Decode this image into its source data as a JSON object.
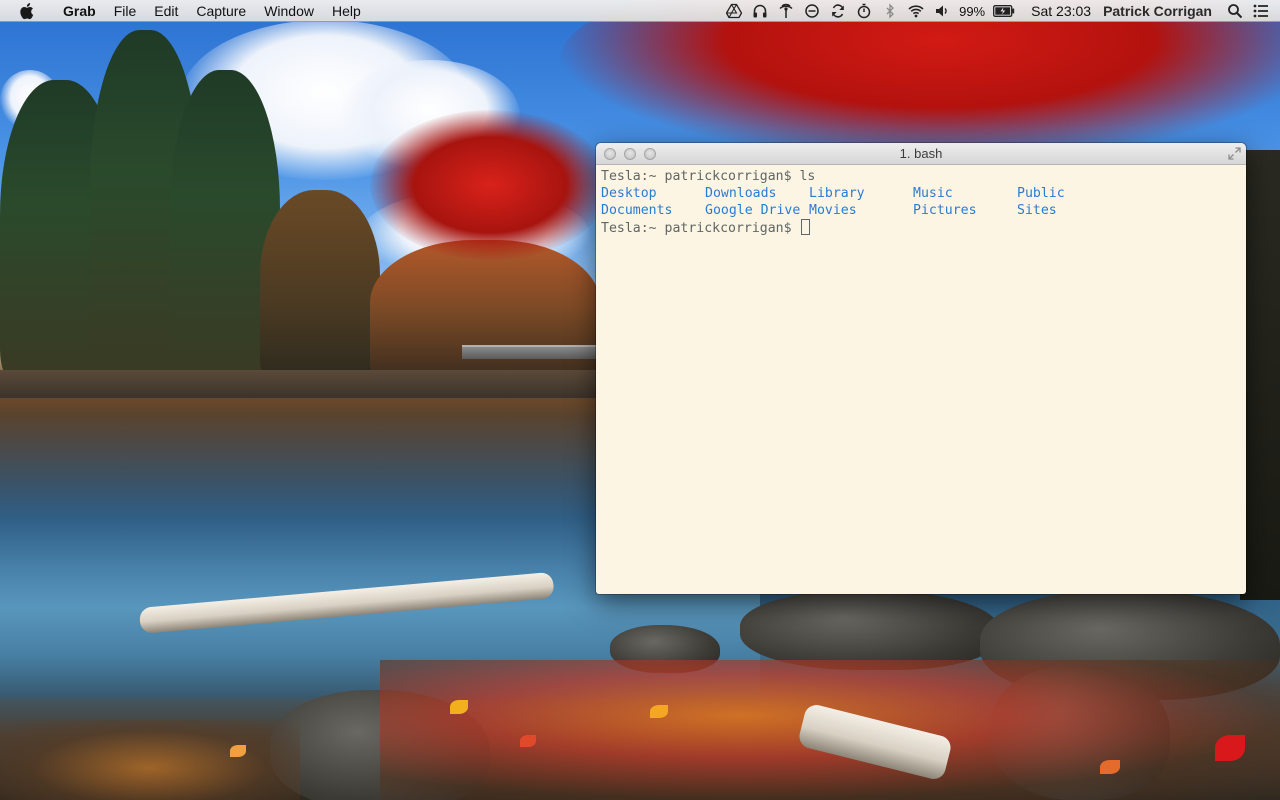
{
  "menubar": {
    "app_name": "Grab",
    "menus": [
      "File",
      "Edit",
      "Capture",
      "Window",
      "Help"
    ],
    "status_icons": [
      "google-drive-icon",
      "headphones-icon",
      "antenna-icon",
      "do-not-disturb-icon",
      "sync-icon",
      "timer-icon",
      "bluetooth-icon",
      "wifi-icon",
      "volume-icon"
    ],
    "battery_percent": "99%",
    "clock": "Sat 23:03",
    "user_name": "Patrick Corrigan"
  },
  "terminal": {
    "title": "1. bash",
    "prompt_1": "Tesla:~ patrickcorrigan$ ls",
    "ls_entries": [
      "Desktop",
      "Downloads",
      "Library",
      "Music",
      "Public",
      "Documents",
      "Google Drive",
      "Movies",
      "Pictures",
      "Sites"
    ],
    "prompt_2": "Tesla:~ patrickcorrigan$ ",
    "colors": {
      "background": "#fdf5e3",
      "text": "#5f6666",
      "directory": "#2a7bd0"
    }
  }
}
